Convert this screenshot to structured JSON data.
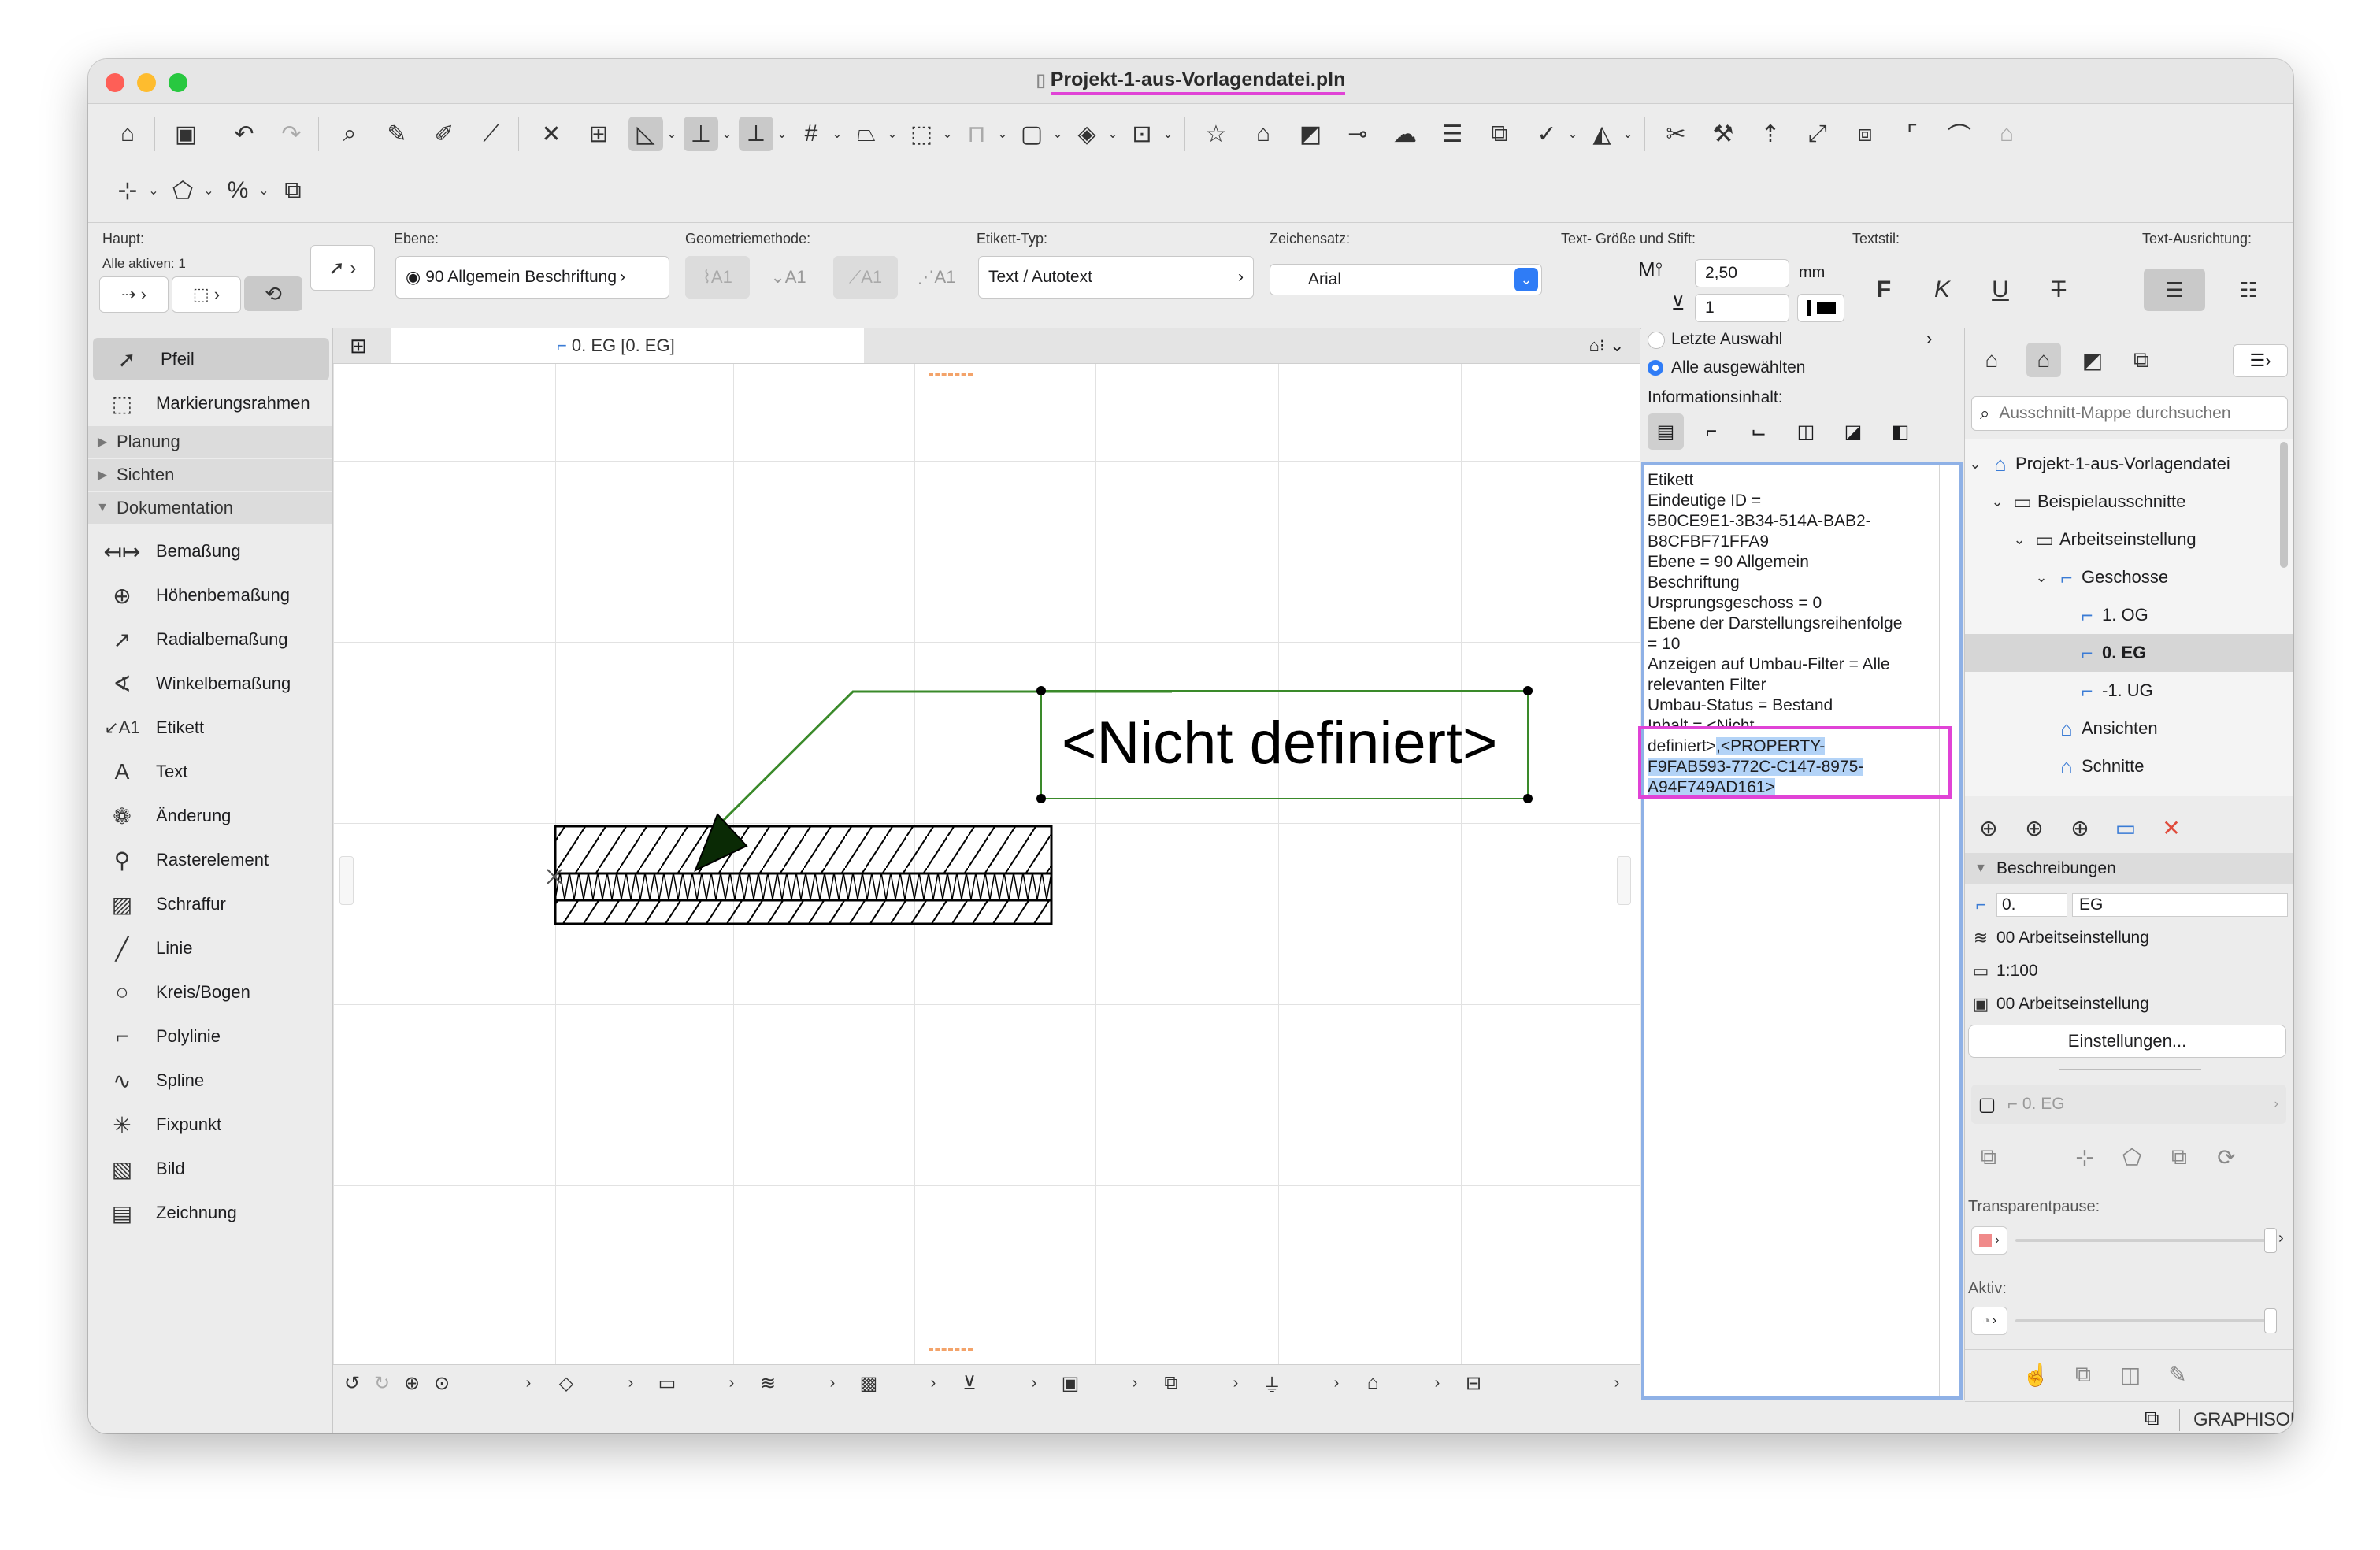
{
  "window": {
    "title": "Projekt-1-aus-Vorlagendatei.pln",
    "file_icon": "document-icon"
  },
  "infobox": {
    "main_label": "Haupt:",
    "selected_count": "Alle aktiven: 1",
    "layer_label": "Ebene:",
    "layer_value": "90 Allgemein Beschriftung",
    "geometry_label": "Geometriemethode:",
    "label_type_label": "Etikett-Typ:",
    "label_type_value": "Text / Autotext",
    "font_label": "Zeichensatz:",
    "font_value": "Arial",
    "text_size_label": "Text- Größe und Stift:",
    "text_size_value": "2,50",
    "text_size_unit": "mm",
    "pen_value": "1",
    "text_style_label": "Textstil:",
    "style_bold": "F",
    "style_italic": "K",
    "style_underline": "U",
    "style_strike": "T",
    "alignment_label": "Text-Ausrichtung:"
  },
  "toolbox": {
    "tools_top": [
      {
        "label": "Pfeil",
        "icon": "arrow-pointer-icon"
      },
      {
        "label": "Markierungsrahmen",
        "icon": "marquee-icon"
      }
    ],
    "groups": [
      "Planung",
      "Sichten",
      "Dokumentation"
    ],
    "doc_tools": [
      {
        "label": "Bemaßung",
        "icon": "dimension-icon"
      },
      {
        "label": "Höhenbemaßung",
        "icon": "level-dimension-icon"
      },
      {
        "label": "Radialbemaßung",
        "icon": "radial-dimension-icon"
      },
      {
        "label": "Winkelbemaßung",
        "icon": "angle-dimension-icon"
      },
      {
        "label": "Etikett",
        "icon": "label-icon"
      },
      {
        "label": "Text",
        "icon": "text-icon"
      },
      {
        "label": "Änderung",
        "icon": "change-icon"
      },
      {
        "label": "Rasterelement",
        "icon": "grid-element-icon"
      },
      {
        "label": "Schraffur",
        "icon": "fill-icon"
      },
      {
        "label": "Linie",
        "icon": "line-icon"
      },
      {
        "label": "Kreis/Bogen",
        "icon": "circle-icon"
      },
      {
        "label": "Polylinie",
        "icon": "polyline-icon"
      },
      {
        "label": "Spline",
        "icon": "spline-icon"
      },
      {
        "label": "Fixpunkt",
        "icon": "hotspot-icon"
      },
      {
        "label": "Bild",
        "icon": "image-icon"
      },
      {
        "label": "Zeichnung",
        "icon": "drawing-icon"
      }
    ]
  },
  "canvas": {
    "tab_label": "0. EG [0. EG]",
    "label_text": "<Nicht definiert>"
  },
  "info_panel": {
    "radio_last": "Letzte Auswahl",
    "radio_all": "Alle ausgewählten",
    "content_label": "Informationsinhalt:",
    "lines": [
      "Etikett",
      "Eindeutige ID =",
      "5B0CE9E1-3B34-514A-BAB2-",
      "B8CFBF71FFA9",
      "Ebene = 90 Allgemein",
      "Beschriftung",
      "Ursprungsgeschoss = 0",
      "Ebene der Darstellungsreihenfolge",
      "= 10",
      "Anzeigen auf Umbau-Filter = Alle",
      "relevanten Filter",
      "Umbau-Status = Bestand",
      "Inhalt = <Nicht"
    ],
    "line_prefix": "definiert>",
    "highlight_1": ",<PROPERTY-",
    "highlight_2": "F9FAB593-772C-C147-8975-",
    "highlight_3": "A94F749AD161>"
  },
  "navigator": {
    "search_placeholder": "Ausschnitt-Mappe durchsuchen",
    "tree": [
      {
        "label": "Projekt-1-aus-Vorlagendatei",
        "level": 0,
        "chev": "⌄",
        "icon": "project-icon"
      },
      {
        "label": "Beispielausschnitte",
        "level": 1,
        "chev": "⌄",
        "icon": "folder-icon"
      },
      {
        "label": "Arbeitseinstellung",
        "level": 2,
        "chev": "⌄",
        "icon": "folder-icon"
      },
      {
        "label": "Geschosse",
        "level": 3,
        "chev": "⌄",
        "icon": "stories-icon"
      },
      {
        "label": "1. OG",
        "level": 4,
        "chev": "",
        "icon": "story-icon"
      },
      {
        "label": "0. EG",
        "level": 4,
        "chev": "",
        "icon": "story-icon",
        "selected": true
      },
      {
        "label": "-1. UG",
        "level": 4,
        "chev": "",
        "icon": "story-icon"
      },
      {
        "label": "Ansichten",
        "level": 3,
        "chev": "",
        "icon": "elevation-icon"
      },
      {
        "label": "Schnitte",
        "level": 3,
        "chev": "",
        "icon": "section-icon"
      }
    ],
    "descriptions_header": "Beschreibungen",
    "id_value": "0.",
    "name_value": "EG",
    "layer_combo": "00 Arbeitseinstellung",
    "scale": "1:100",
    "model_view": "00 Arbeitseinstellung",
    "settings_button": "Einstellungen...",
    "source_view": "0. EG",
    "transparent_label": "Transparentpause:",
    "active_label": "Aktiv:",
    "graphisoft_id": "GRAPHISOFT ID"
  },
  "colors": {
    "accent": "#2f7cf6",
    "highlight": "#e043d6",
    "selection": "#b3d3f7",
    "leader_line": "#3a8a2a"
  }
}
